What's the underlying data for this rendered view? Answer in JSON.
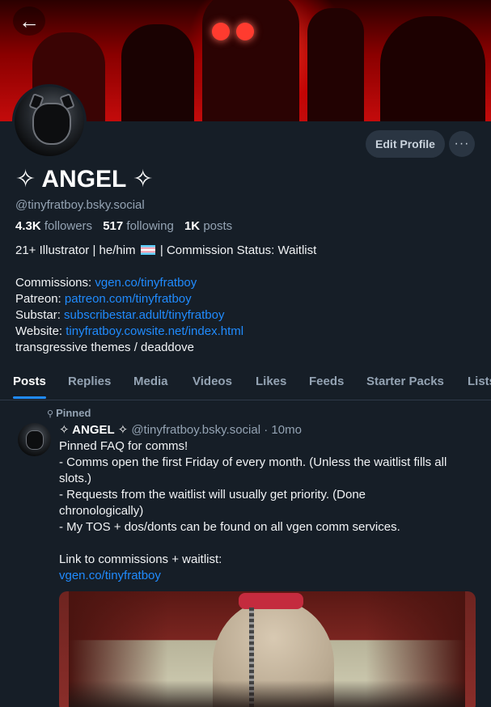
{
  "profile": {
    "display_name": "✧ ANGEL ✧",
    "handle": "@tinyfratboy.bsky.social",
    "followers_count": "4.3K",
    "followers_label": "followers",
    "following_count": "517",
    "following_label": "following",
    "posts_count": "1K",
    "posts_label": "posts",
    "edit_profile_label": "Edit Profile",
    "more_label": "···"
  },
  "bio": {
    "line1_a": "21+ Illustrator | he/him",
    "line1_b": "| Commission Status: Waitlist",
    "commissions_label": "Commissions:",
    "commissions_link": "vgen.co/tinyfratboy",
    "patreon_label": "Patreon:",
    "patreon_link": "patreon.com/tinyfratboy",
    "substar_label": "Substar:",
    "substar_link": "subscribestar.adult/tinyfratboy",
    "website_label": "Website:",
    "website_link": "tinyfratboy.cowsite.net/index.html",
    "last_line": "transgressive themes / deaddove"
  },
  "tabs": [
    "Posts",
    "Replies",
    "Media",
    "Videos",
    "Likes",
    "Feeds",
    "Starter Packs",
    "Lists"
  ],
  "post": {
    "pinned_label": "Pinned",
    "author": "✧ ANGEL ✧",
    "handle": "@tinyfratboy.bsky.social",
    "time": "· 10mo",
    "lines": [
      "Pinned FAQ for comms!",
      "- Comms open the first Friday of every month. (Unless the waitlist fills all",
      "slots.)",
      "- Requests from the waitlist will usually get priority. (Done",
      "chronologically)",
      "- My TOS + dos/donts can be found on all vgen comm services.",
      "",
      "Link to commissions + waitlist:"
    ],
    "link": "vgen.co/tinyfratboy"
  },
  "colors": {
    "accent": "#208bfe",
    "background": "#161e27",
    "muted": "#94a3b3"
  },
  "icons": {
    "back": "arrow-left-icon",
    "pin": "pin-icon",
    "more": "ellipsis-icon"
  }
}
